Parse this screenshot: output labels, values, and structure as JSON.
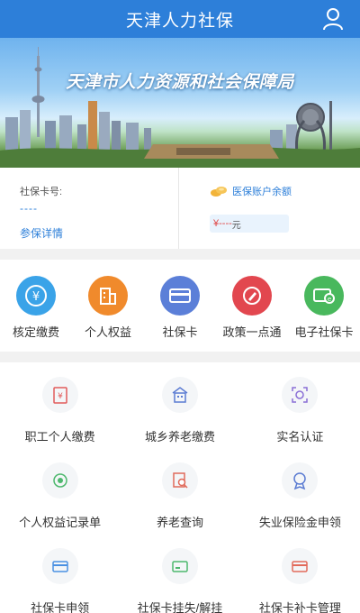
{
  "header": {
    "title": "天津人力社保"
  },
  "banner": {
    "title": "天津市人力资源和社会保障局"
  },
  "account": {
    "card_label": "社保卡号:",
    "card_value": "----",
    "detail_link": "参保详情",
    "balance_label": "医保账户余额",
    "balance_value": "¥----",
    "balance_unit": "元"
  },
  "quick_actions": [
    {
      "label": "核定缴费",
      "icon": "yen-coin-icon",
      "color": "#3aa3e8"
    },
    {
      "label": "个人权益",
      "icon": "building-icon",
      "color": "#f08a2c"
    },
    {
      "label": "社保卡",
      "icon": "card-icon",
      "color": "#5b7fd8"
    },
    {
      "label": "政策一点通",
      "icon": "pen-icon",
      "color": "#e2474f"
    },
    {
      "label": "电子社保卡",
      "icon": "e-card-icon",
      "color": "#49b85d"
    }
  ],
  "services": [
    {
      "label": "职工个人缴费",
      "icon": "payment-doc-icon",
      "color": "#e25b5b"
    },
    {
      "label": "城乡养老缴费",
      "icon": "pension-building-icon",
      "color": "#5a7bd2"
    },
    {
      "label": "实名认证",
      "icon": "face-scan-icon",
      "color": "#8a6fd6"
    },
    {
      "label": "个人权益记录单",
      "icon": "record-icon",
      "color": "#4db86d"
    },
    {
      "label": "养老查询",
      "icon": "search-doc-icon",
      "color": "#e06a5a"
    },
    {
      "label": "失业保险金申领",
      "icon": "medal-icon",
      "color": "#5a7bd2"
    },
    {
      "label": "社保卡申领",
      "icon": "card-apply-icon",
      "color": "#4a90e2"
    },
    {
      "label": "社保卡挂失/解挂",
      "icon": "card-lock-icon",
      "color": "#4db86d"
    },
    {
      "label": "社保卡补卡管理",
      "icon": "card-reissue-icon",
      "color": "#e26a5a"
    }
  ]
}
